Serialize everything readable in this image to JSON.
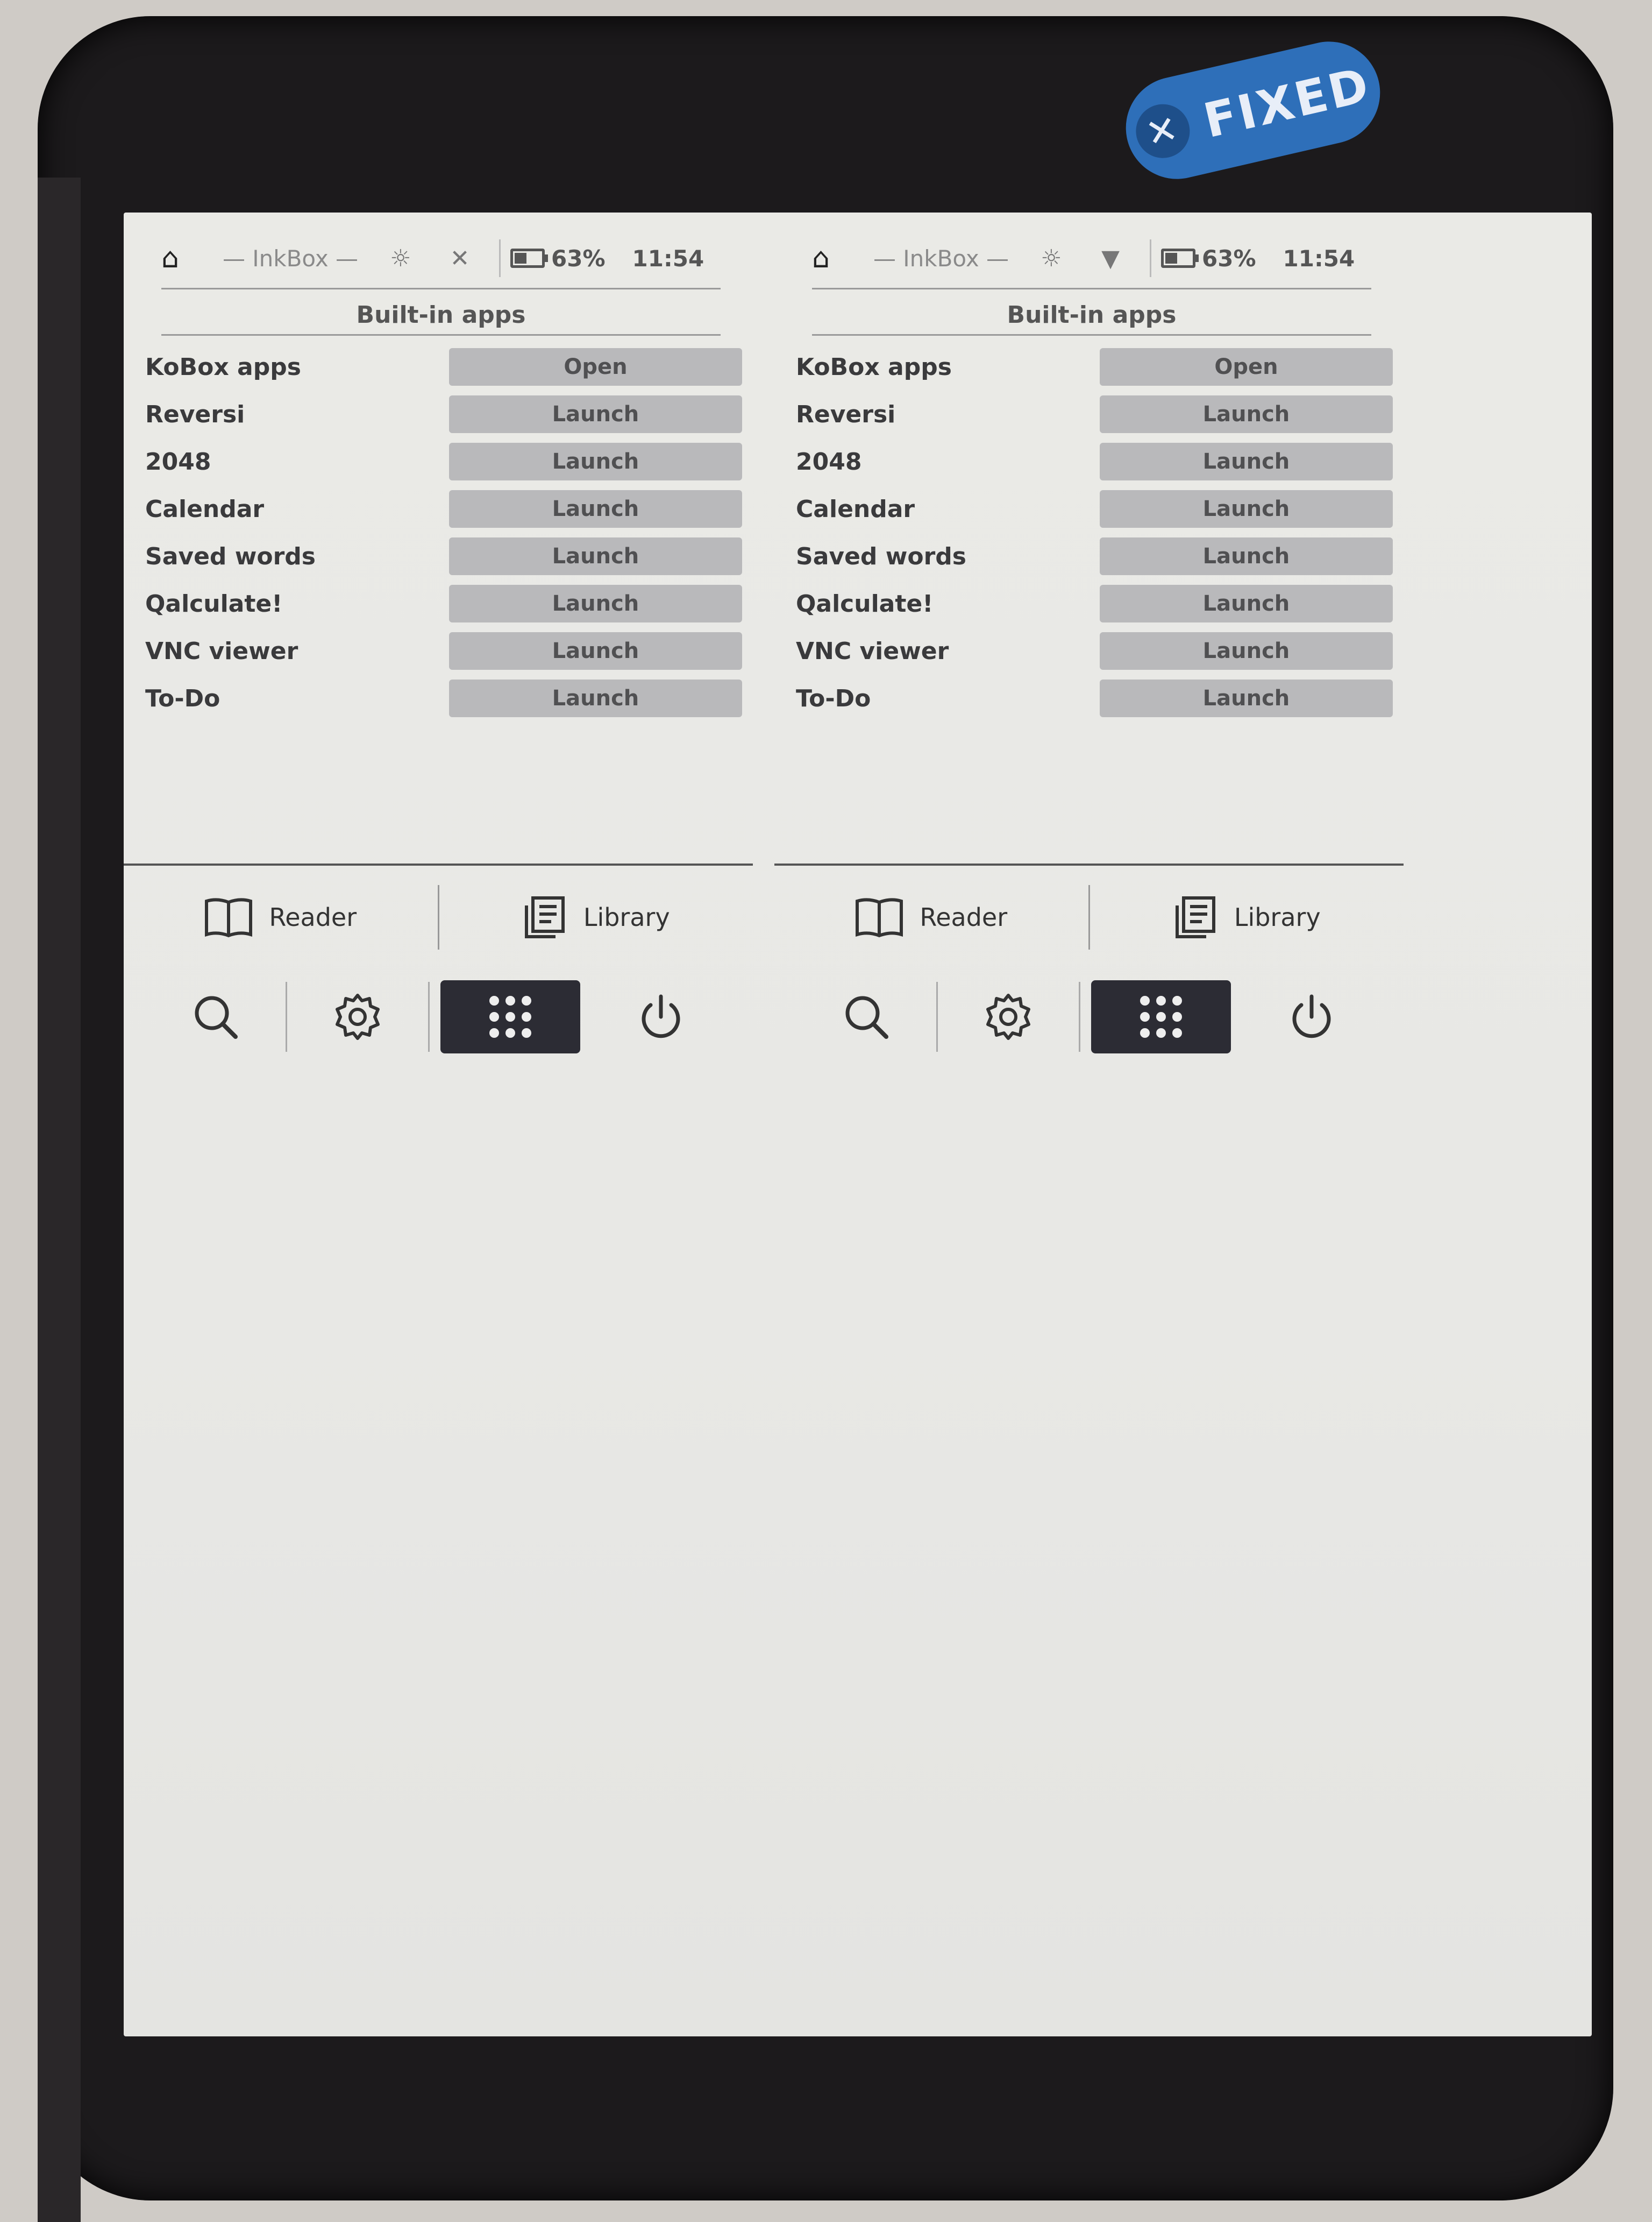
{
  "badge": {
    "label": "FIXED"
  },
  "panes": [
    {
      "status": {
        "title": "— InkBox —",
        "battery": "63%",
        "time": "11:54"
      },
      "section_title": "Built-in apps",
      "apps": [
        {
          "name": "KoBox apps",
          "action": "Open"
        },
        {
          "name": "Reversi",
          "action": "Launch"
        },
        {
          "name": "2048",
          "action": "Launch"
        },
        {
          "name": "Calendar",
          "action": "Launch"
        },
        {
          "name": "Saved words",
          "action": "Launch"
        },
        {
          "name": "Qalculate!",
          "action": "Launch"
        },
        {
          "name": "VNC viewer",
          "action": "Launch"
        },
        {
          "name": "To-Do",
          "action": "Launch"
        }
      ],
      "nav": {
        "reader": "Reader",
        "library": "Library"
      }
    },
    {
      "status": {
        "title": "— InkBox —",
        "battery": "63%",
        "time": "11:54"
      },
      "section_title": "Built-in apps",
      "apps": [
        {
          "name": "KoBox apps",
          "action": "Open"
        },
        {
          "name": "Reversi",
          "action": "Launch"
        },
        {
          "name": "2048",
          "action": "Launch"
        },
        {
          "name": "Calendar",
          "action": "Launch"
        },
        {
          "name": "Saved words",
          "action": "Launch"
        },
        {
          "name": "Qalculate!",
          "action": "Launch"
        },
        {
          "name": "VNC viewer",
          "action": "Launch"
        },
        {
          "name": "To-Do",
          "action": "Launch"
        }
      ],
      "nav": {
        "reader": "Reader",
        "library": "Library"
      }
    }
  ],
  "icons": {
    "home": "home-icon",
    "brightness": "brightness-icon",
    "wifi": "wifi-off-icon",
    "battery": "battery-icon",
    "reader": "book-icon",
    "library": "library-icon",
    "search": "search-icon",
    "settings": "gear-icon",
    "apps": "apps-grid-icon",
    "power": "power-icon"
  },
  "colors": {
    "badge": "#2e6fb9",
    "active_tab": "#2c2c34",
    "button": "#b9b9bb"
  }
}
